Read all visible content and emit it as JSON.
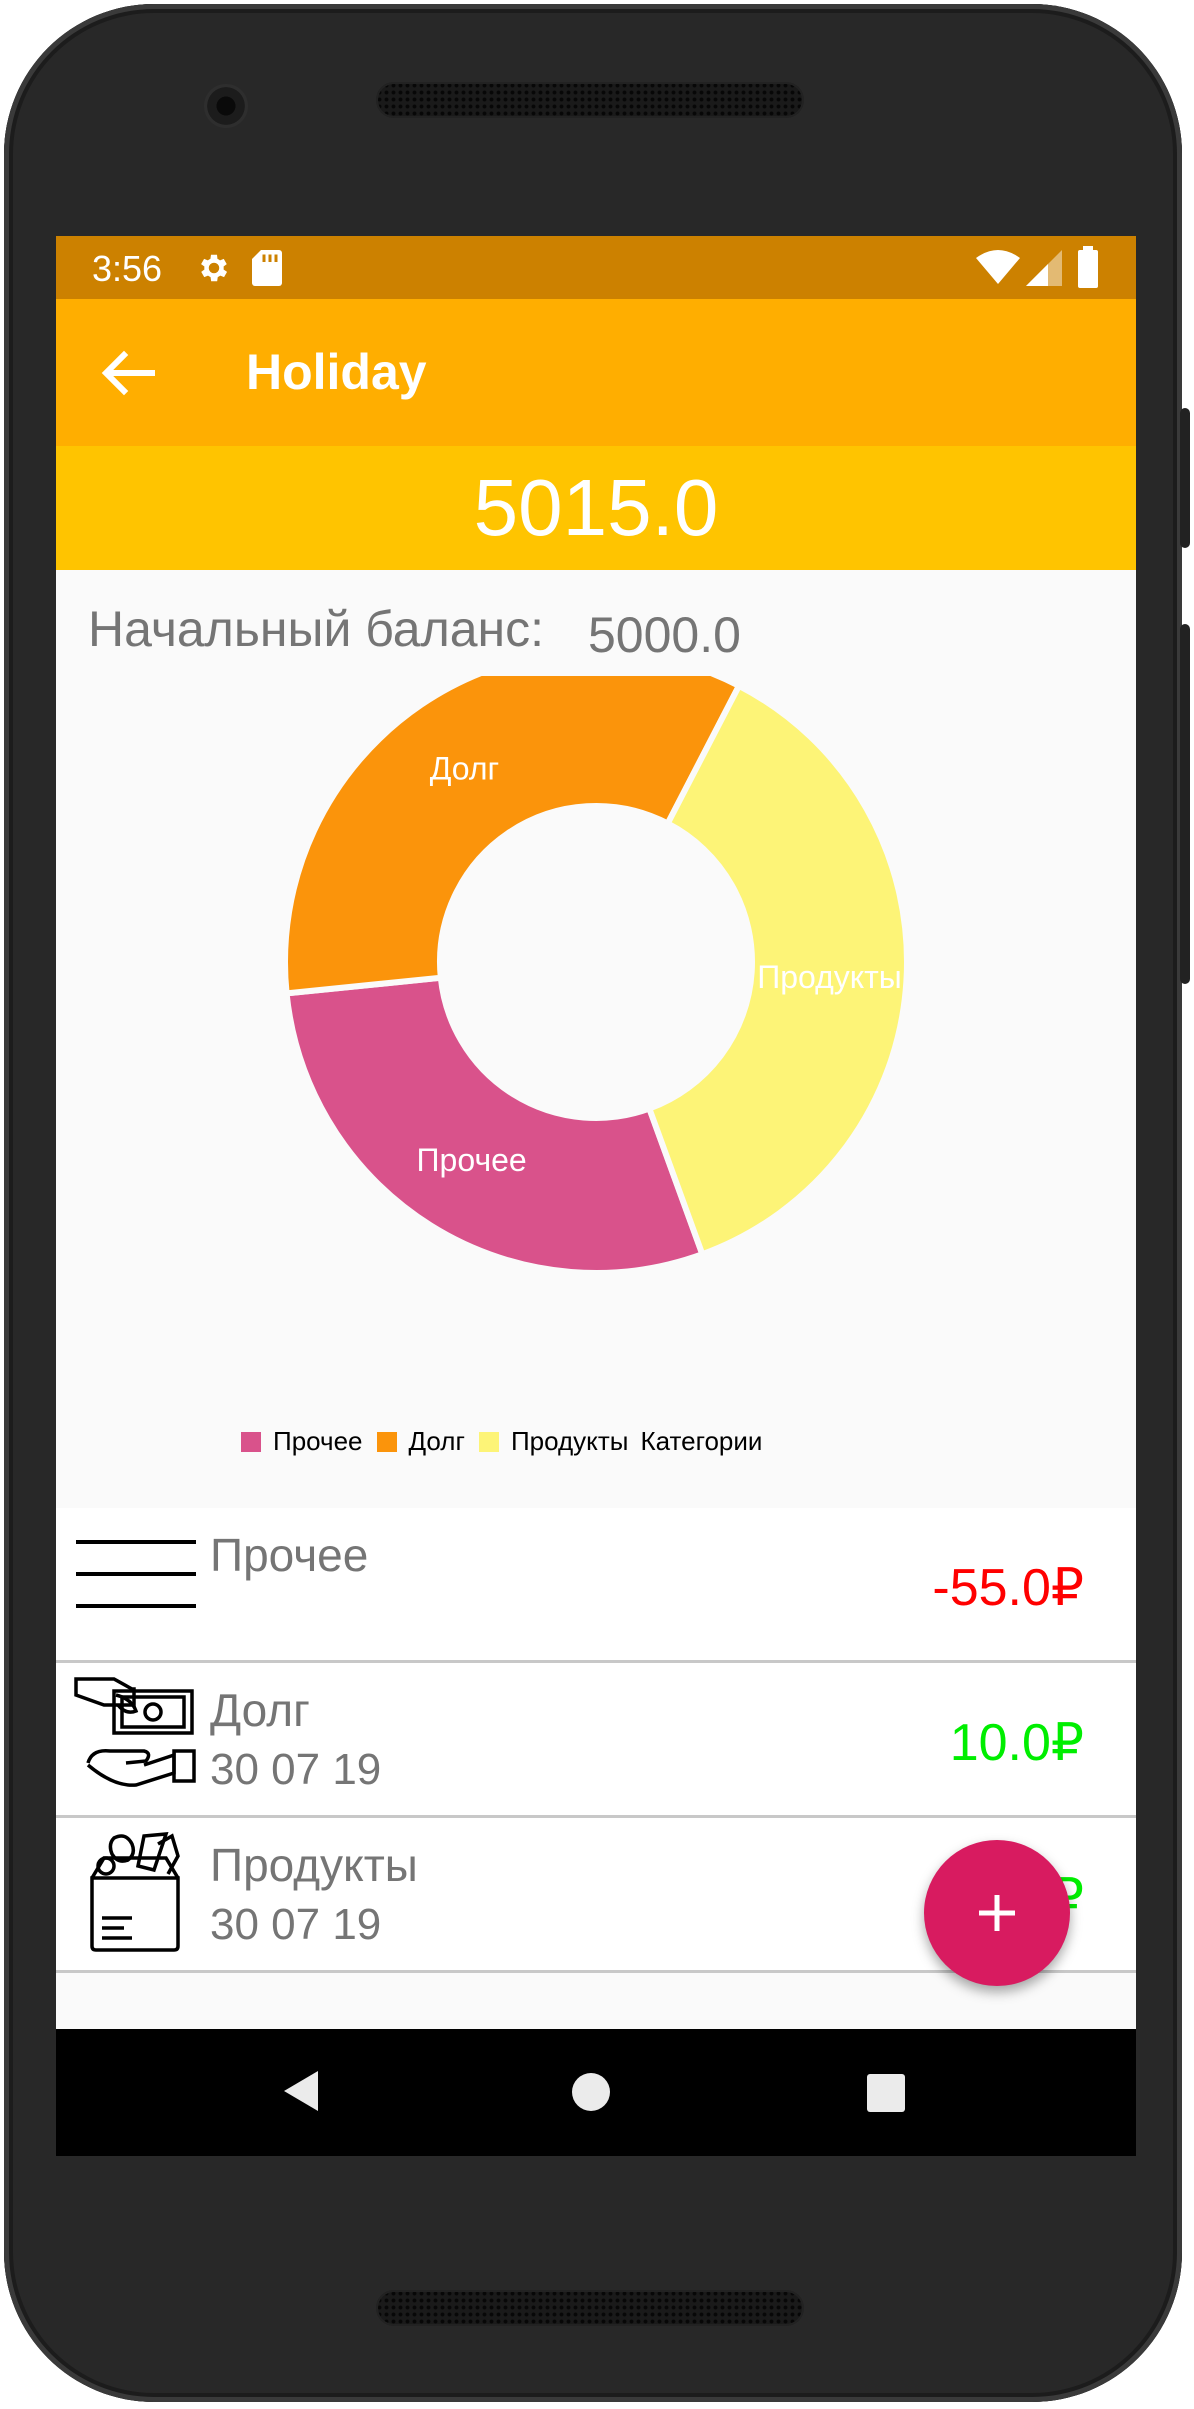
{
  "status_bar": {
    "time": "3:56"
  },
  "toolbar": {
    "title": "Holiday"
  },
  "balance": {
    "current": "5015.0"
  },
  "initial_balance": {
    "label": "Начальный баланс:",
    "value": "5000.0"
  },
  "chart_data": {
    "type": "pie",
    "categories": [
      "Прочее",
      "Долг",
      "Продукты"
    ],
    "values": [
      55,
      65,
      70
    ],
    "colors": [
      "#d9528b",
      "#fb940b",
      "#fdf477"
    ],
    "legend": {
      "title": "Категории",
      "position": "bottom-center"
    }
  },
  "transactions": [
    {
      "title": "Прочее",
      "date": "",
      "amount": "-55.0₽",
      "color": "#ff0000",
      "icon": "list-icon"
    },
    {
      "title": "Долг",
      "date": "30 07 19",
      "amount": "10.0₽",
      "color": "#00ee00",
      "icon": "money-hand-icon"
    },
    {
      "title": "Продукты",
      "date": "30 07 19",
      "amount": "₽",
      "color": "#00ee00",
      "icon": "grocery-bag-icon"
    }
  ],
  "colors": {
    "status_bar": "#cc8100",
    "toolbar": "#ffae00",
    "balance_bar": "#ffc400",
    "fab": "#d81b60"
  }
}
